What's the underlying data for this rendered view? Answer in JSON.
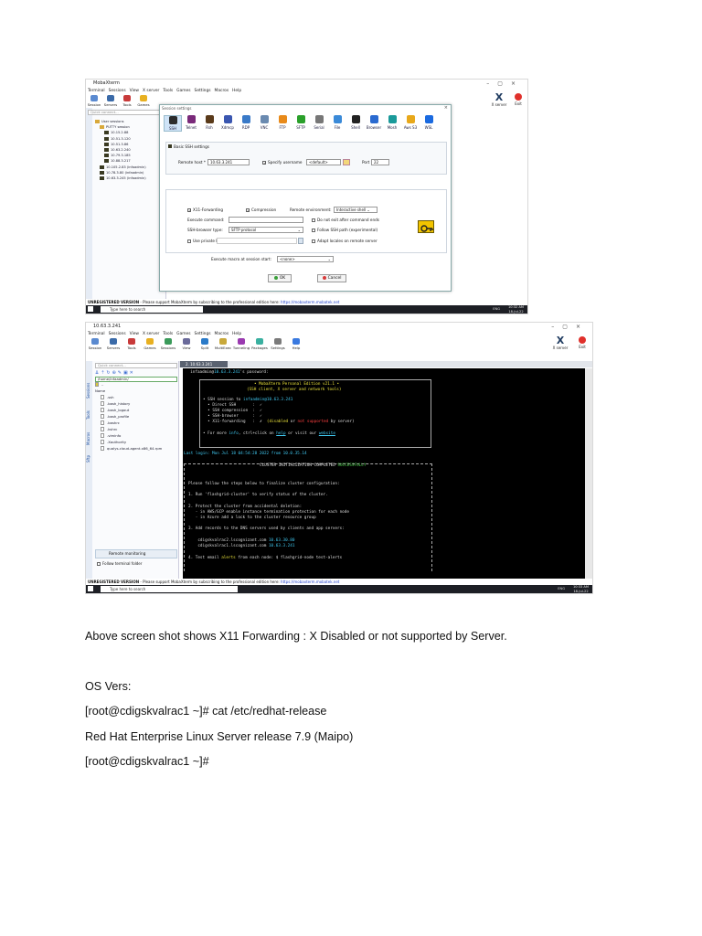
{
  "shot1": {
    "app_title": "MobaXterm",
    "menu": [
      "Terminal",
      "Sessions",
      "View",
      "X server",
      "Tools",
      "Games",
      "Settings",
      "Macros",
      "Help"
    ],
    "toolbar": [
      "Session",
      "Servers",
      "Tools",
      "Games"
    ],
    "xserver_label": "X server",
    "exit_label": "Exit",
    "quick_connect": "Quick connect...",
    "tree": [
      "User sessions",
      "PUTTY session",
      "10.15.2.88",
      "10.51.3.120",
      "10.51.3.86",
      "10.63.2.240",
      "10.79.3.185",
      "10.88.3.217",
      "10.105.2.83 (infaadmin)",
      "10.78.3.80 (infaadmin)",
      "10.63.3.245 (infaadmin)"
    ],
    "dialog": {
      "title": "Session settings",
      "protocols": [
        {
          "label": "SSH",
          "color": "#2c2c2c"
        },
        {
          "label": "Telnet",
          "color": "#7a2a7a"
        },
        {
          "label": "Rsh",
          "color": "#5a3a1a"
        },
        {
          "label": "Xdmcp",
          "color": "#3a56b0"
        },
        {
          "label": "RDP",
          "color": "#3a7ac8"
        },
        {
          "label": "VNC",
          "color": "#6a8ab0"
        },
        {
          "label": "FTP",
          "color": "#e88a1a"
        },
        {
          "label": "SFTP",
          "color": "#2aa02a"
        },
        {
          "label": "Serial",
          "color": "#777777"
        },
        {
          "label": "File",
          "color": "#3a8ad8"
        },
        {
          "label": "Shell",
          "color": "#222222"
        },
        {
          "label": "Browser",
          "color": "#2a6ad0"
        },
        {
          "label": "Mosh",
          "color": "#1a9a9a"
        },
        {
          "label": "Aws S3",
          "color": "#e8a81a"
        },
        {
          "label": "WSL",
          "color": "#1a6ae0"
        }
      ],
      "basic_header": "Basic SSH settings",
      "remote_host_label": "Remote host *",
      "remote_host_value": "10.63.3.241",
      "specify_username_label": "Specify username",
      "username_value": "<default>",
      "port_label": "Port",
      "port_value": "22",
      "subtabs": [
        "Advanced SSH settings",
        "Terminal settings",
        "Network settings",
        "Bookmark settings"
      ],
      "x11_label": "X11-Forwarding",
      "compression_label": "Compression",
      "remote_env_label": "Remote environment:",
      "remote_env_value": "Interactive shell",
      "execute_cmd_label": "Execute command:",
      "do_not_exit_label": "Do not exit after command ends",
      "ssh_browser_label": "SSH-browser type:",
      "ssh_browser_value": "SFTP protocol",
      "follow_ssh_label": "Follow SSH path (experimental)",
      "private_key_label": "Use private key",
      "adapt_locales_label": "Adapt locales on remote server",
      "macro_label": "Execute macro at session start:",
      "macro_value": "<none>",
      "ok_label": "OK",
      "cancel_label": "Cancel"
    },
    "unregistered": "UNREGISTERED VERSION",
    "support_text": " -  Please support MobaXterm by subscribing to the professional edition here:  ",
    "support_url": "https://mobaxterm.mobatek.net",
    "search_placeholder": "Type here to search",
    "clock_time": "10:32 AM",
    "clock_date": "18-Jul-22",
    "tray_lang": "ENG"
  },
  "shot2": {
    "app_title": "10.63.3.241",
    "menu": [
      "Terminal",
      "Sessions",
      "View",
      "X server",
      "Tools",
      "Games",
      "Settings",
      "Macros",
      "Help"
    ],
    "toolbar": [
      "Session",
      "Servers",
      "Tools",
      "Games",
      "Sessions",
      "View",
      "Split",
      "MultiExec",
      "Tunneling",
      "Packages",
      "Settings",
      "Help"
    ],
    "xserver_label": "X server",
    "exit_label": "Exit",
    "quick_connect": "Quick connect...",
    "tab_label": "2. 10.63.3.241",
    "path": "/home/infaadmin/",
    "files": [
      "..",
      "Name",
      ".ssh",
      ".bash_history",
      ".bash_logout",
      ".bash_profile",
      ".bashrc",
      ".kshrc",
      ".viminfo",
      ".Xauthority",
      "qualys-cloud-agent.x86_64.rpm"
    ],
    "remote_monitoring": "Remote monitoring",
    "follow_folder": "Follow terminal folder",
    "vtabs": [
      "Sessions",
      "Tools",
      "Macros",
      "Sftp"
    ],
    "term": {
      "prompt_user": "infaadmin@",
      "prompt_host": "10.63.3.241",
      "prompt_rest": "'s password:",
      "bullet1": "• MobaXterm Personal Edition v21.1 •",
      "bullet2": "(SSH client, X server and network tools)",
      "ssh_session": "• SSH session to ",
      "ssh_target": "infaadmin@10.63.3.241",
      "direct_ssh": "  • Direct SSH       :  ✓",
      "ssh_comp": "  • SSH compression  :  ✓",
      "ssh_browser": "  • SSH-browser      :  ✓",
      "x11_fwd": "  • X11-forwarding   :  ✗  ",
      "x11_disabled": "(disabled",
      "x11_or": " or ",
      "x11_notsup": "not supported",
      "x11_by": " by server)",
      "more_info": "• For more ",
      "info": "info",
      "ctrl": ", ctrl+click on ",
      "help": "help",
      "visit": " or visit our ",
      "website": "website",
      "last_login": "Last login: Mon Jul 18 04:54:28 2022 from ",
      "last_ip": "10.0.35.14",
      "ci_done": "CLUSTER INITIALIZATION COMPLETED ",
      "ci_success": "SUCCESSFULLY",
      "follow_steps": "Please follow the steps below to finalize cluster configuration:",
      "step1": "1. Run 'flashgrid-cluster' to verify status of the cluster.",
      "step2": "2. Protect the cluster from accidental deletion:",
      "step2a": "   - in AWS/GCP enable instance termination protection for each node",
      "step2b": "   - in Azure add a lock to the cluster resource group",
      "step3": "3. Add records to the DNS servers used by clients and app servers:",
      "dns1": "    cdigskvalrac2.lscognizant.com ",
      "dns1_ip": "10.63.30.80",
      "dns2": "    cdigskvalrac1.lscognizant.com ",
      "dns2_ip": "10.63.3.241",
      "step4a": "4. Test email ",
      "step4b": "alerts",
      "step4c": " from each node: $ flashgrid-node test-alerts"
    },
    "unregistered": "UNREGISTERED VERSION",
    "support_text": " -  Please support MobaXterm by subscribing to the professional edition here:  ",
    "support_url": "https://mobaxterm.mobatek.net",
    "search_placeholder": "Type here to search",
    "clock_time": "10:33 AM",
    "clock_date": "18-Jul-22",
    "tray_lang": "ENG"
  },
  "text": {
    "caption": "Above screen shot shows X11 Forwarding : X Disabled or not supported by Server.",
    "os_vers": "OS Vers:",
    "cmd1": "[root@cdigskvalrac1 ~]# cat /etc/redhat-release",
    "release": "Red Hat Enterprise Linux Server release 7.9 (Maipo)",
    "cmd2": "[root@cdigskvalrac1 ~]#"
  }
}
